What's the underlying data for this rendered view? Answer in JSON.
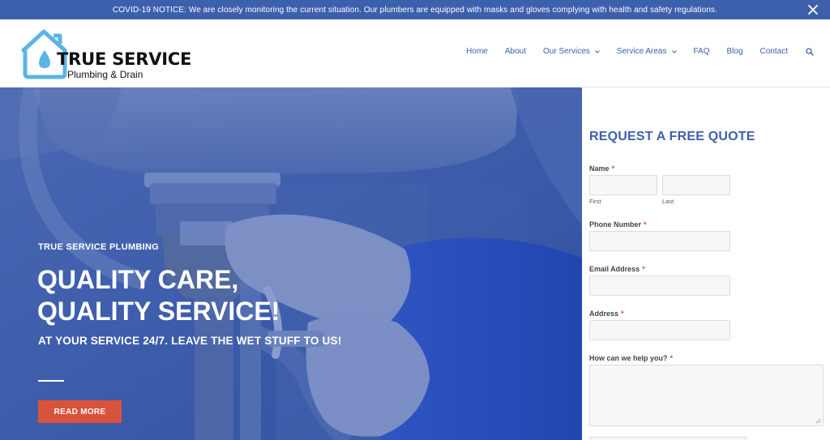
{
  "notice": {
    "text": "COVID-19 NOTICE: We are closely monitoring the current situation. Our plumbers are equipped with masks and gloves complying with health and safety regulations.",
    "close_icon": "close-icon"
  },
  "logo": {
    "title": "TRUE SERVICE",
    "subtitle": "Plumbing & Drain",
    "icon": "house-water-drop-icon"
  },
  "nav": {
    "items": [
      {
        "label": "Home"
      },
      {
        "label": "About"
      },
      {
        "label": "Our Services"
      },
      {
        "label": "Service Areas"
      },
      {
        "label": "FAQ"
      },
      {
        "label": "Blog"
      },
      {
        "label": "Contact"
      }
    ],
    "search_icon": "search-icon"
  },
  "hero": {
    "kicker": "TRUE SERVICE PLUMBING",
    "headline_line1": "QUALITY CARE,",
    "headline_line2": "QUALITY SERVICE!",
    "subheadline": "AT YOUR SERVICE 24/7. LEAVE THE WET STUFF TO US!",
    "button_label": "READ MORE"
  },
  "form": {
    "title": "REQUEST A FREE QUOTE",
    "name_label": "Name",
    "first_label": "First",
    "last_label": "Last",
    "phone_label": "Phone Number",
    "email_label": "Email Address",
    "address_label": "Address",
    "help_label": "How can we help you?",
    "required_mark": "*"
  },
  "colors": {
    "brand_blue": "#3d60ad",
    "accent_red": "#d9533c",
    "logo_light_blue": "#5bb4e8"
  }
}
